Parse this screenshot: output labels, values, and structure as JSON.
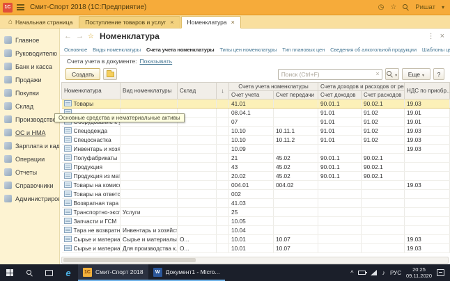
{
  "colors": {
    "titlebar": "#f6ab3a",
    "tab_strip": "#f9df9e",
    "sidebar": "#fdf3d2",
    "link": "#4a7a96",
    "selected_row": "#fcf0b8",
    "taskbar": "#1b1f2a",
    "accent_1c": "#f2b13c"
  },
  "title_bar": {
    "app_icon": "1С",
    "title": "Смит-Спорт 2018 (1С:Предприятие)",
    "user_name": "Ришат"
  },
  "tab_strip": {
    "home": "Начальная страница",
    "tabs": [
      {
        "label": "Поступление товаров и услуг",
        "active": false
      },
      {
        "label": "Номенклатура",
        "active": true
      }
    ]
  },
  "sidebar": {
    "items": [
      {
        "id": "glavnoe",
        "label": "Главное"
      },
      {
        "id": "rukovoditelyu",
        "label": "Руководителю"
      },
      {
        "id": "bank-i-kassa",
        "label": "Банк и касса"
      },
      {
        "id": "prodazhi",
        "label": "Продажи"
      },
      {
        "id": "pokupki",
        "label": "Покупки"
      },
      {
        "id": "sklad",
        "label": "Склад"
      },
      {
        "id": "proizvodstvo",
        "label": "Производство"
      },
      {
        "id": "os-i-nma",
        "label": "ОС и НМА",
        "hover": true
      },
      {
        "id": "zarplata-i-kadry",
        "label": "Зарплата и кадры"
      },
      {
        "id": "operacii",
        "label": "Операции"
      },
      {
        "id": "otchety",
        "label": "Отчеты"
      },
      {
        "id": "spravochniki",
        "label": "Справочники"
      },
      {
        "id": "administrirovanie",
        "label": "Администрирование"
      }
    ],
    "tooltip": "Основные средства и нематериальные активы"
  },
  "content": {
    "page_title": "Номенклатура",
    "nav_tabs": [
      {
        "label": "Основное",
        "active": false
      },
      {
        "label": "Виды номенклатуры",
        "active": false
      },
      {
        "label": "Счета учета номенклатуры",
        "active": true
      },
      {
        "label": "Типы цен номенклатуры",
        "active": false
      },
      {
        "label": "Тип плановых цен",
        "active": false
      },
      {
        "label": "Сведения об алкогольной продукции",
        "active": false
      },
      {
        "label": "Шаблоны ценников и этикеток",
        "active": false
      }
    ],
    "subheader": {
      "label": "Счета учета в документе:",
      "link": "Показывать"
    },
    "toolbar": {
      "create": "Создать",
      "search_placeholder": "Поиск (Ctrl+F)",
      "more": "Еще",
      "help": "?"
    },
    "table": {
      "columns": [
        {
          "key": "nomenclature",
          "label": "Номенклатура"
        },
        {
          "key": "kind",
          "label": "Вид номенклатуры"
        },
        {
          "key": "warehouse",
          "label": "Склад"
        },
        {
          "key": "sort",
          "label": "↓"
        },
        {
          "key": "account",
          "label": "Счет учета"
        },
        {
          "key": "transfer",
          "label": "Счет передачи"
        },
        {
          "key": "income",
          "label": "Счет доходов"
        },
        {
          "key": "expense",
          "label": "Счет расходов"
        },
        {
          "key": "vat",
          "label": "НДС по приобр..."
        }
      ],
      "group_headers": [
        {
          "label": "Счета учета номенклатуры"
        },
        {
          "label": "Счета доходов и расходов от реализации"
        }
      ],
      "rows": [
        {
          "nomenclature": "Товары",
          "kind": "",
          "warehouse": "",
          "account": "41.01",
          "transfer": "",
          "income": "90.01.1",
          "expense": "90.02.1",
          "vat": "19.03",
          "selected": true
        },
        {
          "nomenclature": "",
          "kind": "",
          "warehouse": "",
          "account": "08.04.1",
          "transfer": "",
          "income": "91.01",
          "expense": "91.02",
          "vat": "19.01"
        },
        {
          "nomenclature": "Оборудование к установке",
          "kind": "",
          "warehouse": "",
          "account": "07",
          "transfer": "",
          "income": "91.01",
          "expense": "91.02",
          "vat": "19.01"
        },
        {
          "nomenclature": "Спецодежда",
          "kind": "",
          "warehouse": "",
          "account": "10.10",
          "transfer": "10.11.1",
          "income": "91.01",
          "expense": "91.02",
          "vat": "19.03"
        },
        {
          "nomenclature": "Спецоснастка",
          "kind": "",
          "warehouse": "",
          "account": "10.10",
          "transfer": "10.11.2",
          "income": "91.01",
          "expense": "91.02",
          "vat": "19.03"
        },
        {
          "nomenclature": "Инвентарь и хозяйственн...",
          "kind": "",
          "warehouse": "",
          "account": "10.09",
          "transfer": "",
          "income": "",
          "expense": "",
          "vat": "19.03"
        },
        {
          "nomenclature": "Полуфабрикаты",
          "kind": "",
          "warehouse": "",
          "account": "21",
          "transfer": "45.02",
          "income": "90.01.1",
          "expense": "90.02.1",
          "vat": ""
        },
        {
          "nomenclature": "Продукция",
          "kind": "",
          "warehouse": "",
          "account": "43",
          "transfer": "45.02",
          "income": "90.01.1",
          "expense": "90.02.1",
          "vat": ""
        },
        {
          "nomenclature": "Продукция из материало...",
          "kind": "",
          "warehouse": "",
          "account": "20.02",
          "transfer": "45.02",
          "income": "90.01.1",
          "expense": "90.02.1",
          "vat": ""
        },
        {
          "nomenclature": "Товары на комиссии",
          "kind": "",
          "warehouse": "",
          "account": "004.01",
          "transfer": "004.02",
          "income": "",
          "expense": "",
          "vat": "19.03"
        },
        {
          "nomenclature": "Товары на ответственн...",
          "kind": "",
          "warehouse": "",
          "account": "002",
          "transfer": "",
          "income": "",
          "expense": "",
          "vat": ""
        },
        {
          "nomenclature": "Возвратная тара",
          "kind": "",
          "warehouse": "",
          "account": "41.03",
          "transfer": "",
          "income": "",
          "expense": "",
          "vat": ""
        },
        {
          "nomenclature": "Транспортно-эксп...",
          "kind": "Услуги",
          "warehouse": "",
          "account": "25",
          "transfer": "",
          "income": "",
          "expense": "",
          "vat": ""
        },
        {
          "nomenclature": "Запчасти и ГСМ",
          "kind": "",
          "warehouse": "",
          "account": "10.05",
          "transfer": "",
          "income": "",
          "expense": "",
          "vat": ""
        },
        {
          "nomenclature": "Тара не возвратная",
          "kind": "Инвентарь и хозяйственн...",
          "warehouse": "",
          "account": "10.04",
          "transfer": "",
          "income": "",
          "expense": "",
          "vat": ""
        },
        {
          "nomenclature": "Сырье и материалы",
          "kind": "Сырье и материалы",
          "warehouse": "О...",
          "account": "10.01",
          "transfer": "10.07",
          "income": "",
          "expense": "",
          "vat": "19.03"
        },
        {
          "nomenclature": "Сырье и материалы",
          "kind": "Для производства к...",
          "warehouse": "О...",
          "account": "10.01",
          "transfer": "10.07",
          "income": "",
          "expense": "",
          "vat": "19.03"
        }
      ]
    }
  },
  "taskbar": {
    "apps": [
      {
        "icon_label": "1С",
        "label": "Смит-Спорт 2018",
        "active": true
      },
      {
        "icon_label": "W",
        "label": "Документ1 - Micro...",
        "active": false
      }
    ],
    "tray": {
      "lang": "РУС",
      "time": "20:25",
      "date": "09.11.2020"
    }
  }
}
